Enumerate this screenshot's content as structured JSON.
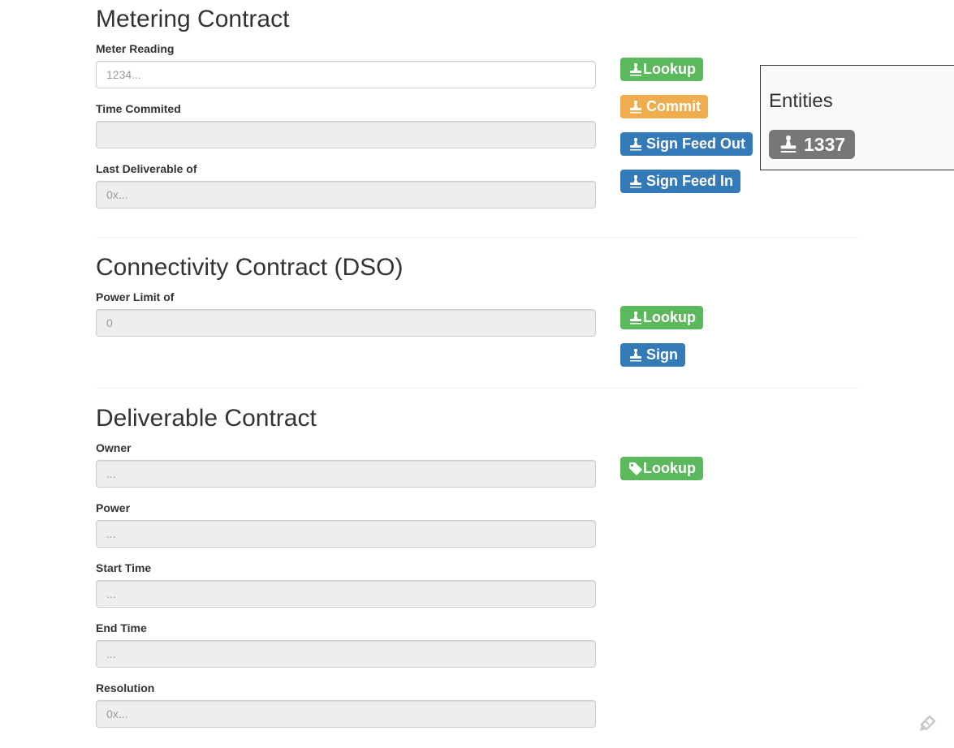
{
  "metering": {
    "title": "Metering Contract",
    "fields": {
      "meter_reading": {
        "label": "Meter Reading",
        "placeholder": "1234...",
        "value": ""
      },
      "time_committed": {
        "label": "Time Commited",
        "placeholder": "",
        "value": ""
      },
      "last_deliverable": {
        "label": "Last Deliverable of",
        "placeholder": "0x...",
        "value": ""
      }
    },
    "buttons": {
      "lookup": "Lookup",
      "commit": "Commit",
      "sign_feed_out": "Sign Feed Out",
      "sign_feed_in": "Sign Feed In"
    }
  },
  "connectivity": {
    "title": "Connectivity Contract (DSO)",
    "fields": {
      "power_limit": {
        "label": "Power Limit of",
        "placeholder": "0",
        "value": ""
      }
    },
    "buttons": {
      "lookup": "Lookup",
      "sign": "Sign"
    }
  },
  "deliverable": {
    "title": "Deliverable Contract",
    "fields": {
      "owner": {
        "label": "Owner",
        "placeholder": "...",
        "value": ""
      },
      "power": {
        "label": "Power",
        "placeholder": "...",
        "value": ""
      },
      "start_time": {
        "label": "Start Time",
        "placeholder": "...",
        "value": ""
      },
      "end_time": {
        "label": "End Time",
        "placeholder": "...",
        "value": ""
      },
      "resolution": {
        "label": "Resolution",
        "placeholder": "0x...",
        "value": ""
      }
    },
    "buttons": {
      "lookup": "Lookup"
    }
  },
  "entities": {
    "title": "Entities",
    "items": [
      {
        "id": "1337",
        "icon": "stamp-icon"
      }
    ]
  },
  "icons": {
    "button_icon": "stamp-icon",
    "deliverable_lookup_icon": "tag-icon",
    "corner_icon": "feedback-icon"
  },
  "colors": {
    "success": "#5cb85c",
    "warning": "#f0ad4e",
    "primary": "#337ab7",
    "badge": "#777777",
    "readonly_bg": "#eeeeee"
  }
}
